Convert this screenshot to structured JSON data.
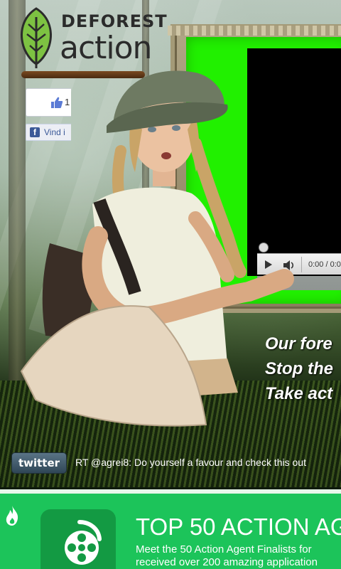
{
  "brand": {
    "logo_line1": "DEFOREST",
    "logo_line2": "action"
  },
  "social": {
    "like_count": "1",
    "facebook_button_label": "Vind i"
  },
  "video_player": {
    "time": "0:00 / 0:0",
    "progress": 0
  },
  "slogans": [
    "Our fore",
    "Stop the",
    "Take act"
  ],
  "twitter": {
    "logo_text": "twitter",
    "tweet": "RT @agrei8: Do yourself a favour and check this out"
  },
  "banner": {
    "title": "TOP 50 ACTION AG",
    "description_line1": "Meet the 50 Action Agent Finalists for",
    "description_line2": "received over 200 amazing application"
  },
  "colors": {
    "greenscreen": "#21f000",
    "banner_green": "#1cc45a",
    "progress_red": "#c81f1f",
    "facebook_blue": "#3b5998"
  },
  "icons": {
    "like": "thumbs-up-icon",
    "facebook": "facebook-icon",
    "play": "play-icon",
    "volume": "volume-icon",
    "flame": "flame-icon",
    "reel": "film-reel-icon"
  }
}
